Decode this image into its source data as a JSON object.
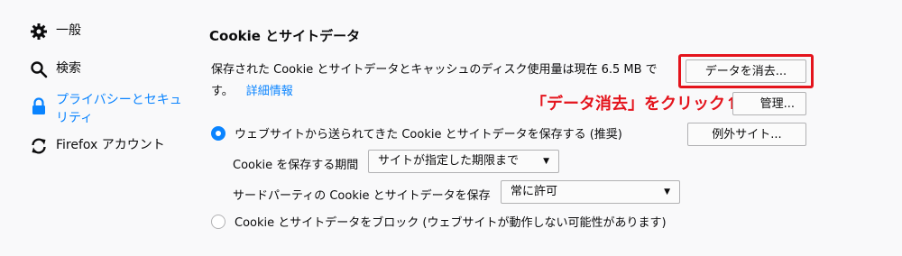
{
  "sidebar": {
    "items": [
      {
        "label": "一般",
        "icon": "gear-icon"
      },
      {
        "label": "検索",
        "icon": "search-icon"
      },
      {
        "label": "プライバシーとセキュリティ",
        "icon": "lock-icon",
        "selected": true
      },
      {
        "label": "Firefox アカウント",
        "icon": "sync-icon"
      }
    ],
    "accent_color": "#0a84ff"
  },
  "section": {
    "title": "Cookie とサイトデータ",
    "description": "保存された Cookie とサイトデータとキャッシュのディスク使用量は現在 6.5 MB です。",
    "learn_more": "詳細情報"
  },
  "buttons": {
    "clear_data": "データを消去...",
    "manage": "管理...",
    "exceptions": "例外サイト..."
  },
  "annotation": {
    "text": "「データ消去」をクリック↑",
    "color": "#e4141c"
  },
  "options": {
    "accept": "ウェブサイトから送られてきた Cookie とサイトデータを保存する (推奨)",
    "keep_until_label": "Cookie を保存する期間",
    "keep_until_value": "サイトが指定した期限まで",
    "third_party_label": "サードパーティの Cookie とサイトデータを保存",
    "third_party_value": "常に許可",
    "block": "Cookie とサイトデータをブロック (ウェブサイトが動作しない可能性があります)"
  }
}
